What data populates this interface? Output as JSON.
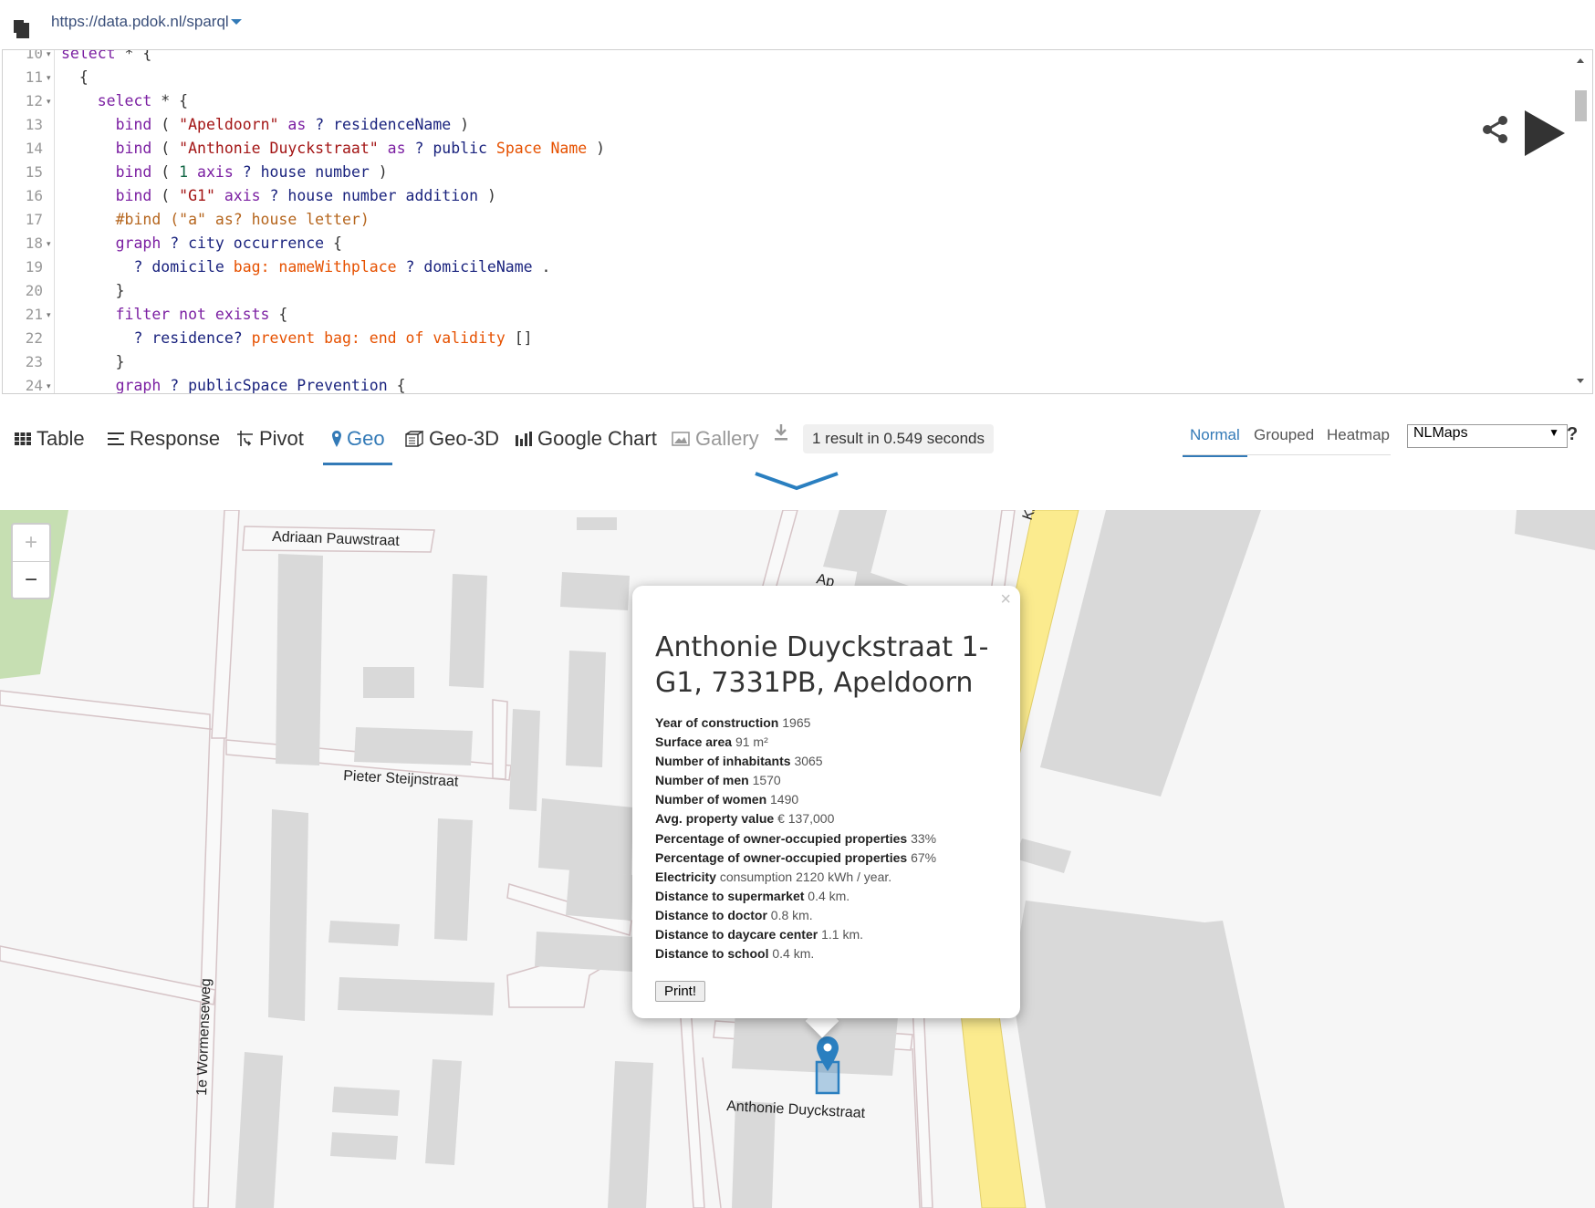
{
  "endpoint": {
    "url": "https://data.pdok.nl/sparql"
  },
  "editor": {
    "lines": [
      {
        "n": "10",
        "fold": "▾",
        "segments": [
          [
            "kw",
            "select"
          ],
          [
            "",
            " * {"
          ]
        ]
      },
      {
        "n": "11",
        "fold": "▾",
        "segments": [
          [
            "",
            "  {"
          ]
        ]
      },
      {
        "n": "12",
        "fold": "▾",
        "segments": [
          [
            "",
            "    "
          ],
          [
            "kw",
            "select"
          ],
          [
            "",
            " * {"
          ]
        ]
      },
      {
        "n": "13",
        "fold": "",
        "segments": [
          [
            "",
            "      "
          ],
          [
            "kw",
            "bind"
          ],
          [
            "",
            " ( "
          ],
          [
            "str",
            "\"Apeldoorn\""
          ],
          [
            "",
            " "
          ],
          [
            "kw",
            "as"
          ],
          [
            "",
            " "
          ],
          [
            "var",
            "? residenceName"
          ],
          [
            "",
            " )"
          ]
        ]
      },
      {
        "n": "14",
        "fold": "",
        "segments": [
          [
            "",
            "      "
          ],
          [
            "kw",
            "bind"
          ],
          [
            "",
            " ( "
          ],
          [
            "str",
            "\"Anthonie Duyckstraat\""
          ],
          [
            "",
            " "
          ],
          [
            "kw",
            "as"
          ],
          [
            "",
            " "
          ],
          [
            "var",
            "? public"
          ],
          [
            "",
            " "
          ],
          [
            "pn",
            "Space Name"
          ],
          [
            "",
            " )"
          ]
        ]
      },
      {
        "n": "15",
        "fold": "",
        "segments": [
          [
            "",
            "      "
          ],
          [
            "kw",
            "bind"
          ],
          [
            "",
            " ( "
          ],
          [
            "num",
            "1"
          ],
          [
            "",
            " "
          ],
          [
            "kw",
            "axis"
          ],
          [
            "",
            " "
          ],
          [
            "var",
            "? house number"
          ],
          [
            "",
            " )"
          ]
        ]
      },
      {
        "n": "16",
        "fold": "",
        "segments": [
          [
            "",
            "      "
          ],
          [
            "kw",
            "bind"
          ],
          [
            "",
            " ( "
          ],
          [
            "str",
            "\"G1\""
          ],
          [
            "",
            " "
          ],
          [
            "kw",
            "axis"
          ],
          [
            "",
            " "
          ],
          [
            "var",
            "? house number addition"
          ],
          [
            "",
            " )"
          ]
        ]
      },
      {
        "n": "17",
        "fold": "",
        "segments": [
          [
            "",
            "      "
          ],
          [
            "com",
            "#bind (\"a\" as? house letter)"
          ]
        ]
      },
      {
        "n": "18",
        "fold": "▾",
        "segments": [
          [
            "",
            "      "
          ],
          [
            "kw",
            "graph"
          ],
          [
            "",
            " "
          ],
          [
            "var",
            "? city occurrence"
          ],
          [
            "",
            " {"
          ]
        ]
      },
      {
        "n": "19",
        "fold": "",
        "segments": [
          [
            "",
            "        "
          ],
          [
            "var",
            "? domicile"
          ],
          [
            "",
            " "
          ],
          [
            "pn",
            "bag: nameWithplace"
          ],
          [
            "",
            " "
          ],
          [
            "var",
            "? domicileName"
          ],
          [
            "",
            " ."
          ]
        ]
      },
      {
        "n": "20",
        "fold": "",
        "segments": [
          [
            "",
            "      }"
          ]
        ]
      },
      {
        "n": "21",
        "fold": "▾",
        "segments": [
          [
            "",
            "      "
          ],
          [
            "kw",
            "filter not exists"
          ],
          [
            "",
            " {"
          ]
        ]
      },
      {
        "n": "22",
        "fold": "",
        "segments": [
          [
            "",
            "        "
          ],
          [
            "var",
            "? residence?"
          ],
          [
            "",
            " "
          ],
          [
            "pn",
            "prevent bag: end of validity"
          ],
          [
            "",
            " []"
          ]
        ]
      },
      {
        "n": "23",
        "fold": "",
        "segments": [
          [
            "",
            "      }"
          ]
        ]
      },
      {
        "n": "24",
        "fold": "▾",
        "segments": [
          [
            "",
            "      "
          ],
          [
            "kw",
            "graph"
          ],
          [
            "",
            " "
          ],
          [
            "var",
            "? publicSpace Prevention"
          ],
          [
            "",
            " {"
          ]
        ]
      }
    ]
  },
  "tabs": {
    "table": "Table",
    "response": "Response",
    "pivot": "Pivot",
    "geo": "Geo",
    "geo3d": "Geo-3D",
    "google_chart": "Google Chart",
    "gallery": "Gallery"
  },
  "result_info": "1 result in 0.549 seconds",
  "geo_modes": {
    "normal": "Normal",
    "grouped": "Grouped",
    "heatmap": "Heatmap"
  },
  "layer": {
    "selected": "NLMaps",
    "options": [
      "NLMaps"
    ]
  },
  "help": "?",
  "map": {
    "zoom_in": "+",
    "zoom_out": "−",
    "streets": {
      "adriaan": "Adriaan Pauwstraat",
      "pieter": "Pieter Steijnstraat",
      "wormenseweg": "1e Wormenseweg",
      "anthonie": "Anthonie Duyckstraat",
      "partial_top": "Ap",
      "partial_k": "Ka"
    },
    "colors": {
      "road_yellow": "#fbeb8e",
      "building": "#d9d9d9",
      "park": "#c8e0b4",
      "marker": "#2a7fc0"
    }
  },
  "popup": {
    "close": "×",
    "title": "Anthonie Duyckstraat 1-G1, 7331PB, Apeldoorn",
    "rows": [
      {
        "label": "Year of construction",
        "value": "1965"
      },
      {
        "label": "Surface area",
        "value": "91 m²"
      },
      {
        "label": "Number of inhabitants",
        "value": "3065"
      },
      {
        "label": "Number of men",
        "value": "1570"
      },
      {
        "label": "Number of women",
        "value": "1490"
      },
      {
        "label": "Avg. property value",
        "value": "€ 137,000"
      },
      {
        "label": "Percentage of owner-occupied properties",
        "value": "33%"
      },
      {
        "label": "Percentage of owner-occupied properties",
        "value": "67%"
      },
      {
        "label": "Electricity",
        "value": "consumption 2120 kWh / year."
      },
      {
        "label": "Distance to supermarket",
        "value": "0.4 km."
      },
      {
        "label": "Distance to doctor",
        "value": "0.8 km."
      },
      {
        "label": "Distance to daycare center",
        "value": "1.1 km."
      },
      {
        "label": "Distance to school",
        "value": "0.4 km."
      }
    ],
    "print": "Print!"
  }
}
